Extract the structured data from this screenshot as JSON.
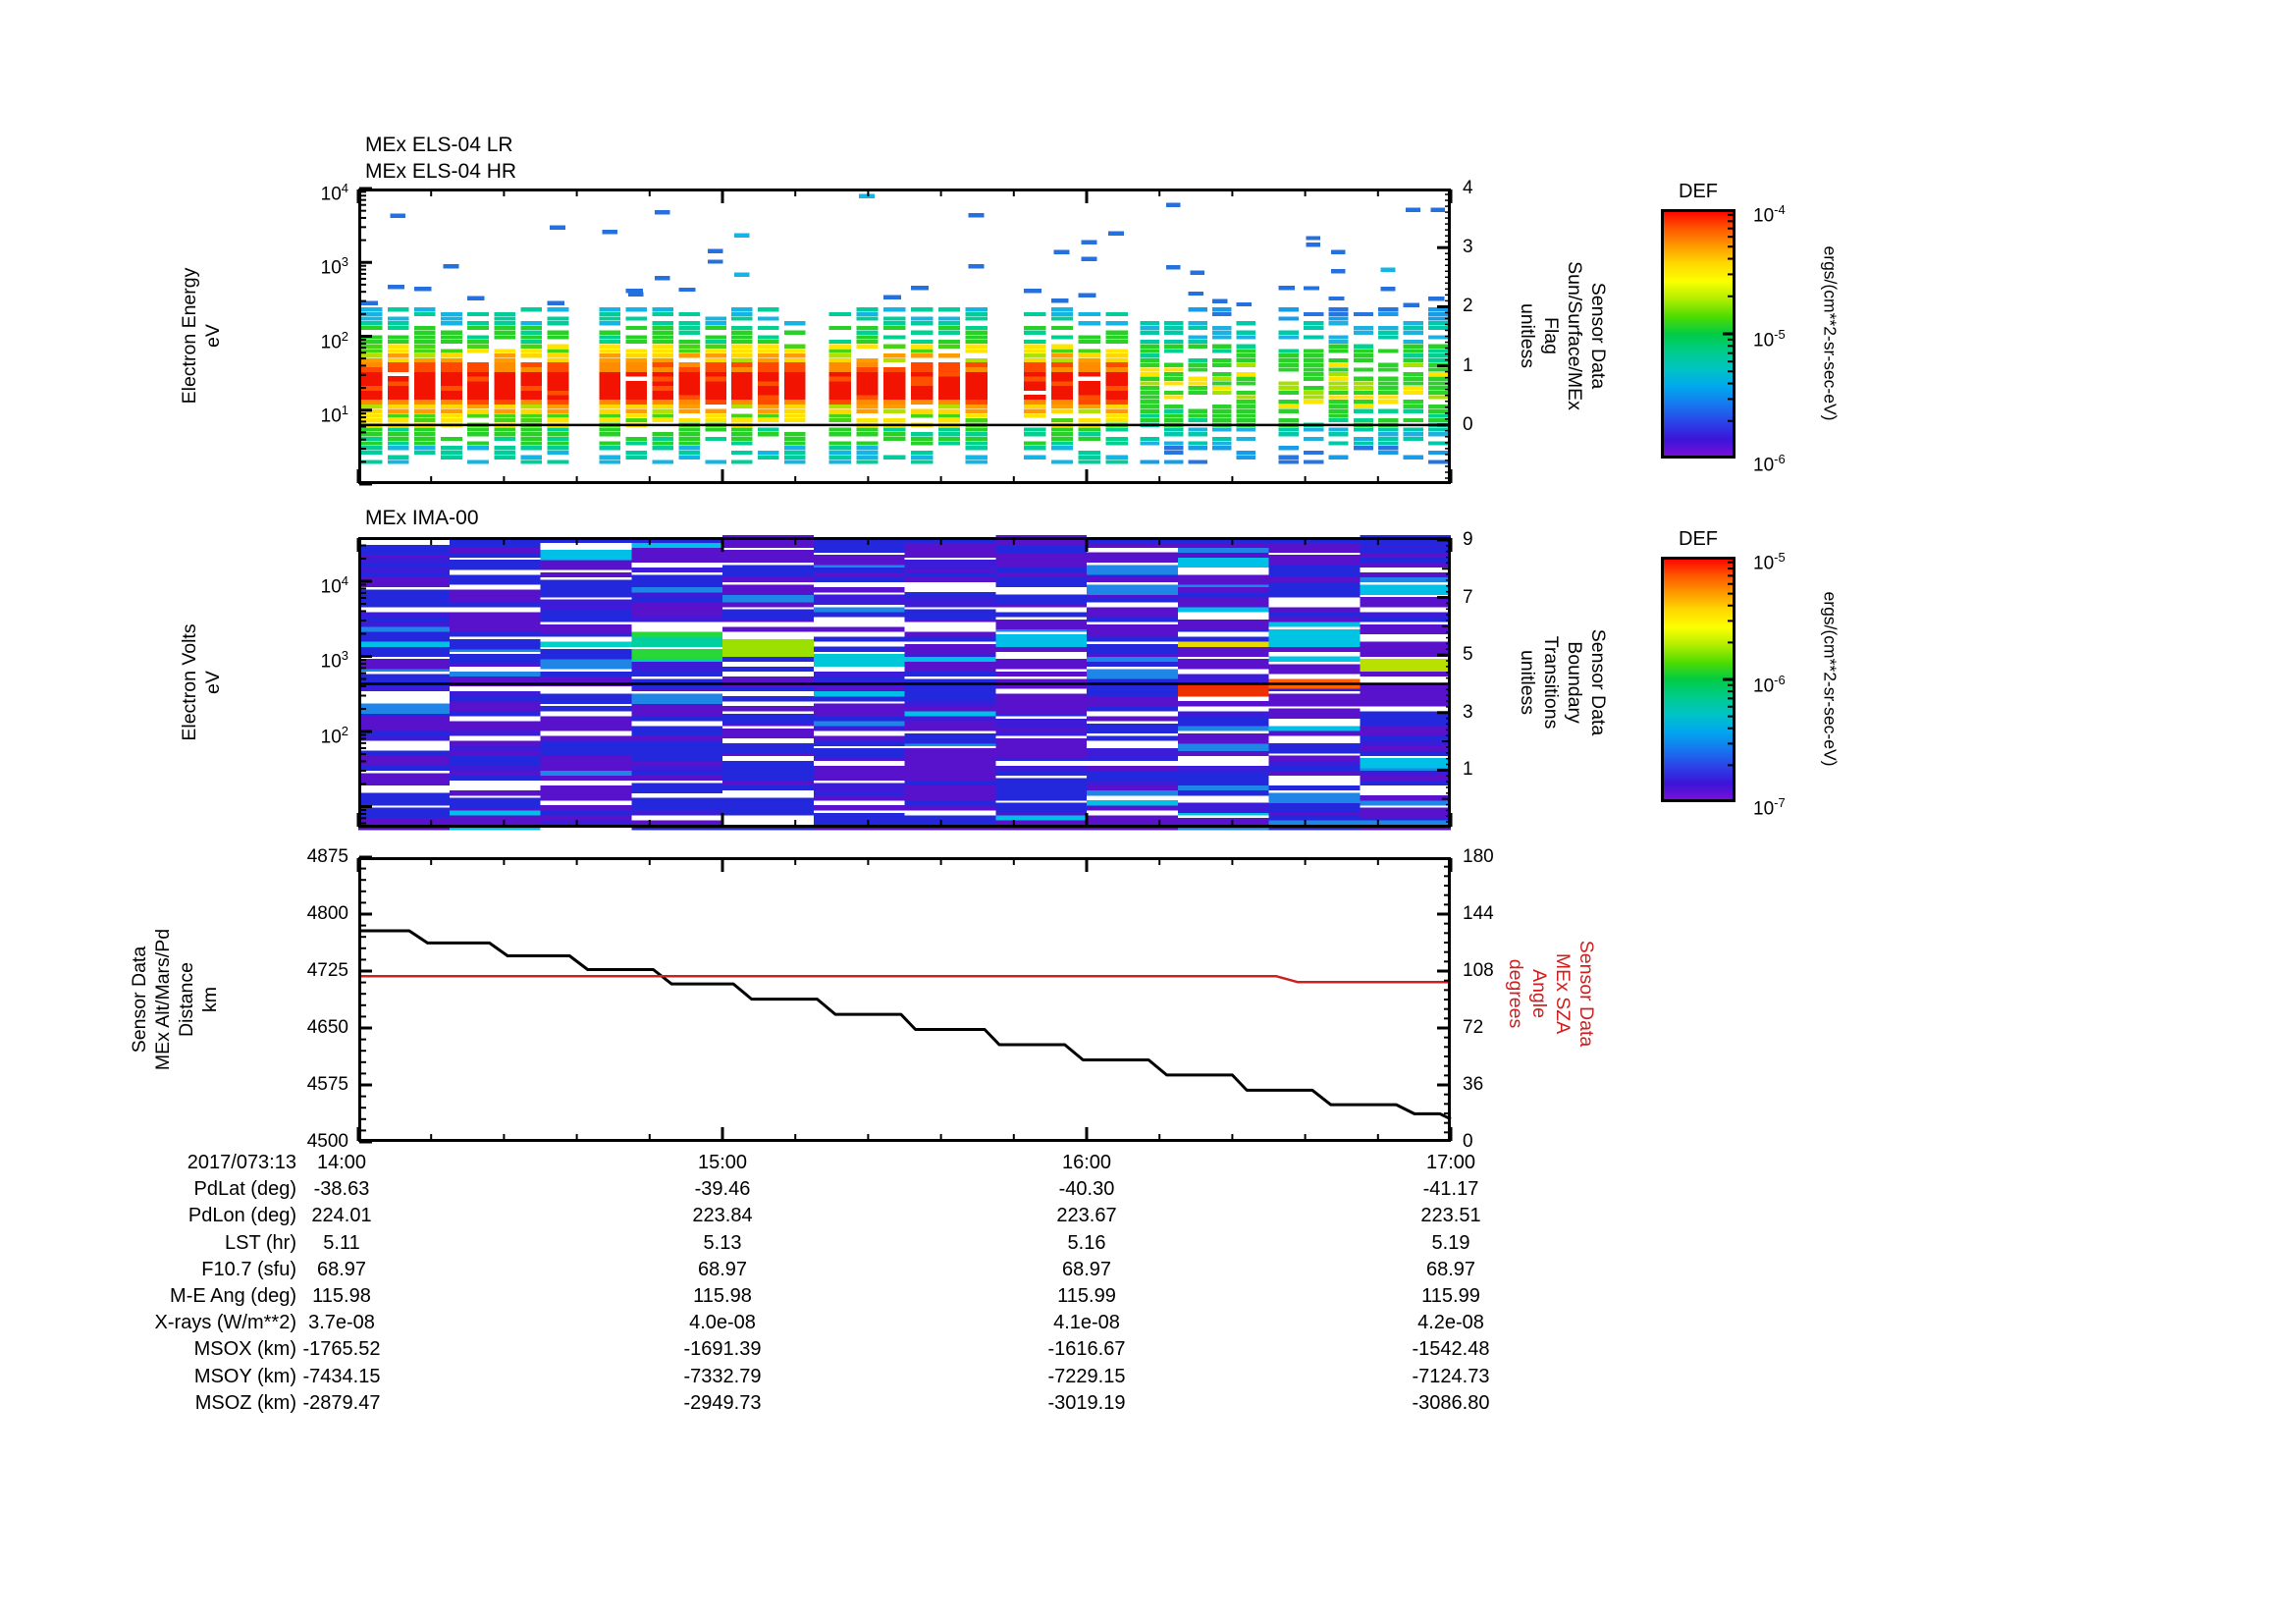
{
  "chart_data": [
    {
      "type": "spectrogram",
      "id": "els",
      "title_lines": [
        "MEx ELS-04 LR",
        "MEx ELS-04 HR"
      ],
      "ylabel_lines": [
        "Electron Energy",
        "eV"
      ],
      "y_scale": "log",
      "y_range_ev": [
        1,
        10000
      ],
      "y_tick_exponents": [
        4,
        3,
        2,
        1
      ],
      "x_range_hours": [
        14,
        17
      ],
      "x_minor_step_hours": 0.2,
      "baseline_ev": 6.3,
      "right_axis": {
        "label_lines": [
          "Sensor Data",
          "Sun/Surface/MEx",
          "Flag",
          "unitless"
        ],
        "range": [
          -1,
          4
        ],
        "major_ticks": [
          0,
          1,
          2,
          3,
          4
        ],
        "minor_step": 0.1
      },
      "colorbar": {
        "title": "DEF",
        "units": "ergs/(cm**2-sr-sec-eV)",
        "tick_exponents": [
          -4,
          -5,
          -6
        ],
        "gradient": [
          "#ff0000",
          "#ff5500",
          "#ff9900",
          "#ffd800",
          "#fbff00",
          "#b4ee00",
          "#50dc00",
          "#00cc44",
          "#00cc8c",
          "#00c4c4",
          "#00a8ee",
          "#1678ee",
          "#2a44e8",
          "#3c14d8",
          "#7a10d8"
        ]
      },
      "content": {
        "description": "Bursty vertical columns of electron flux: intense red core 12-45 eV, yellow/green 45-120 eV, cyan/blue dashes out to ~250 eV and below 10 eV, sparse blue dashes 300 eV - 10 keV; columns after ~16:07 lack the red core (green/cyan only); horizontal black line near 6.3 eV.",
        "seed": 11,
        "core_center_ev": 22,
        "segments": [
          {
            "t0": 14.0,
            "t1": 14.585,
            "cols": 8,
            "strength": 1.0
          },
          {
            "t0": 14.655,
            "t1": 15.235,
            "cols": 8,
            "strength": 1.0
          },
          {
            "t0": 15.285,
            "t1": 15.735,
            "cols": 6,
            "strength": 1.0
          },
          {
            "t0": 15.82,
            "t1": 16.12,
            "cols": 4,
            "strength": 0.95
          },
          {
            "t0": 16.14,
            "t1": 16.47,
            "cols": 5,
            "strength": 0.5
          },
          {
            "t0": 16.52,
            "t1": 17.0,
            "cols": 7,
            "strength": 0.5
          }
        ]
      }
    },
    {
      "type": "spectrogram",
      "id": "ima",
      "title_lines": [
        "MEx IMA-00"
      ],
      "ylabel_lines": [
        "Electron Volts",
        "eV"
      ],
      "y_scale": "log",
      "y_range_ev": [
        5.2,
        38000
      ],
      "y_tick_exponents": [
        4,
        3,
        2
      ],
      "x_range_hours": [
        14,
        17
      ],
      "x_minor_step_hours": 0.2,
      "baseline_ev": 430,
      "right_axis": {
        "label_lines": [
          "Sensor Data",
          "Boundary",
          "Transitions",
          "unitless"
        ],
        "range": [
          -1,
          9.1
        ],
        "major_ticks": [
          1,
          3,
          5,
          7,
          9
        ],
        "minor_step": 0.2
      },
      "colorbar": {
        "title": "DEF",
        "units": "ergs/(cm**2-sr-sec-eV)",
        "tick_exponents": [
          -5,
          -6,
          -7
        ],
        "gradient": [
          "#ff0000",
          "#ff5500",
          "#ff9900",
          "#ffd800",
          "#fbff00",
          "#b4ee00",
          "#50dc00",
          "#00cc44",
          "#00cc8c",
          "#00c4c4",
          "#00a8ee",
          "#1678ee",
          "#2a44e8",
          "#3c14d8",
          "#7a10d8"
        ]
      },
      "content": {
        "description": "Twelve ~15-minute blocks of thin horizontal stripes, mostly violet/blue with white gaps; cyan-green enhancements near 1-2 keV between 14:30-15:30; orange-red, yellow-green and cyan enhancements near 0.3-1.6 keV after 16:15; horizontal black line near 430 eV.",
        "seed": 29,
        "blocks": 12,
        "stripe_colors": [
          "#5812cc",
          "#2428dc",
          "#3c1cd8",
          "#1f86e8",
          "#00c0e8"
        ],
        "enhancements": [
          {
            "block": 2,
            "band_ev": [
              900,
              2200
            ],
            "colors": [
              "#00d0c8",
              "#20c0e8"
            ]
          },
          {
            "block": 3,
            "band_ev": [
              900,
              2100
            ],
            "colors": [
              "#28d838",
              "#00d0a0"
            ]
          },
          {
            "block": 4,
            "band_ev": [
              1000,
              1900
            ],
            "colors": [
              "#30dc30",
              "#9ce000"
            ]
          },
          {
            "block": 5,
            "band_ev": [
              650,
              1200
            ],
            "colors": [
              "#00c8d8"
            ]
          },
          {
            "block": 9,
            "band_ev": [
              1000,
              1600
            ],
            "colors": [
              "#28d030",
              "#e8d800",
              "#ff7000"
            ]
          },
          {
            "block": 9,
            "band_ev": [
              300,
              420
            ],
            "colors": [
              "#ee3000",
              "#ff6000"
            ]
          },
          {
            "block": 10,
            "band_ev": [
              420,
              560
            ],
            "colors": [
              "#ff6000",
              "#e83000"
            ]
          },
          {
            "block": 10,
            "band_ev": [
              900,
              2000
            ],
            "colors": [
              "#00c4e4"
            ]
          },
          {
            "block": 11,
            "band_ev": [
              600,
              950
            ],
            "colors": [
              "#b8e000",
              "#30d840",
              "#00ccc8"
            ]
          }
        ]
      }
    },
    {
      "type": "line",
      "id": "aux",
      "ylabel_lines": [
        "Sensor Data",
        "MEx Alt/Mars/Pd",
        "Distance",
        "km"
      ],
      "y_range_km": [
        4500,
        4875
      ],
      "y_major_ticks": [
        4875,
        4800,
        4725,
        4650,
        4575,
        4500
      ],
      "y_minor_step_km": 15,
      "right_axis": {
        "label_lines": [
          "Sensor Data",
          "MEx SZA",
          "Angle",
          "degrees"
        ],
        "color": "#cc2020",
        "range_deg": [
          0,
          180
        ],
        "major_ticks": [
          180,
          144,
          108,
          72,
          36,
          0
        ],
        "minor_step_deg": 6
      },
      "x_ticks": [
        {
          "hour": 14,
          "label": "14:00"
        },
        {
          "hour": 15,
          "label": "15:00"
        },
        {
          "hour": 16,
          "label": "16:00"
        },
        {
          "hour": 17,
          "label": "17:00"
        }
      ],
      "series": [
        {
          "name": "MEx Alt/Mars/Pd Distance (km)",
          "color": "#000000",
          "axis": "left",
          "points": [
            [
              14.0,
              4778
            ],
            [
              14.14,
              4778
            ],
            [
              14.19,
              4762
            ],
            [
              14.36,
              4762
            ],
            [
              14.41,
              4745
            ],
            [
              14.58,
              4745
            ],
            [
              14.63,
              4727
            ],
            [
              14.81,
              4727
            ],
            [
              14.86,
              4708
            ],
            [
              15.03,
              4708
            ],
            [
              15.08,
              4688
            ],
            [
              15.26,
              4688
            ],
            [
              15.31,
              4668
            ],
            [
              15.49,
              4668
            ],
            [
              15.53,
              4648
            ],
            [
              15.72,
              4648
            ],
            [
              15.76,
              4628
            ],
            [
              15.94,
              4628
            ],
            [
              15.99,
              4608
            ],
            [
              16.17,
              4608
            ],
            [
              16.22,
              4588
            ],
            [
              16.4,
              4588
            ],
            [
              16.44,
              4568
            ],
            [
              16.62,
              4568
            ],
            [
              16.67,
              4549
            ],
            [
              16.85,
              4549
            ],
            [
              16.9,
              4537
            ],
            [
              16.97,
              4537
            ],
            [
              17.0,
              4530
            ]
          ]
        },
        {
          "name": "MEx SZA Angle (deg)",
          "color": "#cc2020",
          "axis": "right",
          "points": [
            [
              14.0,
              104.8
            ],
            [
              16.52,
              104.8
            ],
            [
              16.58,
              101.0
            ],
            [
              17.0,
              101.0
            ]
          ]
        }
      ]
    }
  ],
  "table": {
    "rows": [
      {
        "label": "2017/073:13",
        "values": [
          "14:00",
          "15:00",
          "16:00",
          "17:00"
        ]
      },
      {
        "label": "PdLat (deg)",
        "values": [
          "-38.63",
          "-39.46",
          "-40.30",
          "-41.17"
        ]
      },
      {
        "label": "PdLon (deg)",
        "values": [
          "224.01",
          "223.84",
          "223.67",
          "223.51"
        ]
      },
      {
        "label": "LST (hr)",
        "values": [
          "5.11",
          "5.13",
          "5.16",
          "5.19"
        ]
      },
      {
        "label": "F10.7 (sfu)",
        "values": [
          "68.97",
          "68.97",
          "68.97",
          "68.97"
        ]
      },
      {
        "label": "M-E Ang (deg)",
        "values": [
          "115.98",
          "115.98",
          "115.99",
          "115.99"
        ]
      },
      {
        "label": "X-rays (W/m**2)",
        "values": [
          "3.7e-08",
          "4.0e-08",
          "4.1e-08",
          "4.2e-08"
        ]
      },
      {
        "label": "MSOX (km)",
        "values": [
          "-1765.52",
          "-1691.39",
          "-1616.67",
          "-1542.48"
        ]
      },
      {
        "label": "MSOY (km)",
        "values": [
          "-7434.15",
          "-7332.79",
          "-7229.15",
          "-7124.73"
        ]
      },
      {
        "label": "MSOZ (km)",
        "values": [
          "-2879.47",
          "-2949.73",
          "-3019.19",
          "-3086.80"
        ]
      }
    ]
  }
}
